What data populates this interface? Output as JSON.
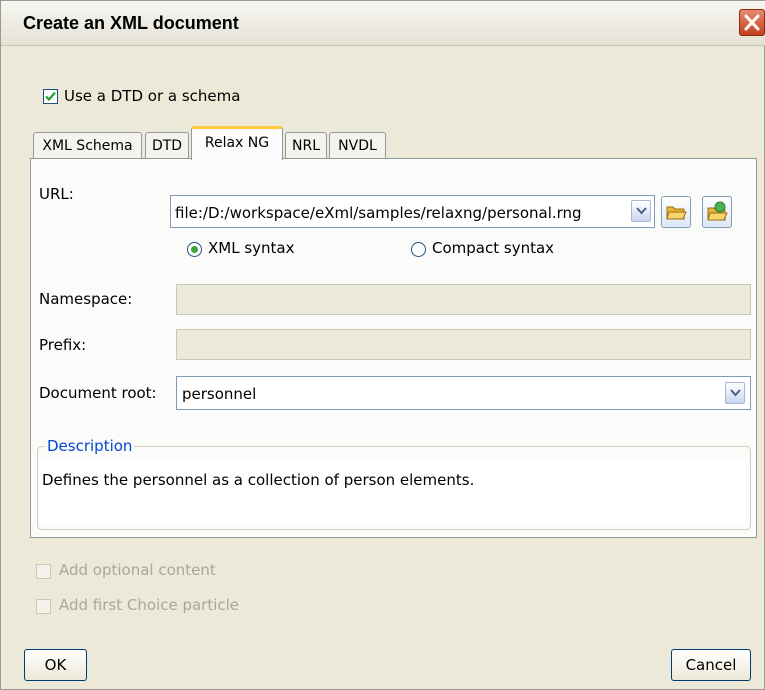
{
  "dialog": {
    "title": "Create an XML document",
    "use_schema_checkbox": {
      "label": "Use a DTD or a schema",
      "checked": true
    }
  },
  "tabs": [
    {
      "label": "XML Schema",
      "active": false
    },
    {
      "label": "DTD",
      "active": false
    },
    {
      "label": "Relax NG",
      "active": true
    },
    {
      "label": "NRL",
      "active": false
    },
    {
      "label": "NVDL",
      "active": false
    }
  ],
  "form": {
    "url_label": "URL:",
    "url_value": "file:/D:/workspace/eXml/samples/relaxng/personal.rng",
    "syntax_options": [
      {
        "label": "XML syntax",
        "selected": true
      },
      {
        "label": "Compact syntax",
        "selected": false
      }
    ],
    "namespace_label": "Namespace:",
    "namespace_value": "",
    "prefix_label": "Prefix:",
    "prefix_value": "",
    "document_root_label": "Document root:",
    "document_root_value": "personnel"
  },
  "description": {
    "legend": "Description",
    "text": "Defines the personnel as a collection of person elements."
  },
  "options": {
    "optional_content": {
      "label": "Add optional content",
      "checked": false,
      "enabled": false
    },
    "first_choice": {
      "label": "Add first Choice particle",
      "checked": false,
      "enabled": false
    }
  },
  "buttons": {
    "ok": "OK",
    "cancel": "Cancel"
  },
  "icons": {
    "close": "close-icon",
    "dropdown": "chevron-down-icon",
    "browse_local": "open-folder-icon",
    "browse_url": "open-url-folder-icon"
  },
  "colors": {
    "dialog_bg": "#ece9d8",
    "active_tab_accent": "#ffc73c",
    "legend_text": "#0046d5",
    "close_button": "#c2411f",
    "checkmark": "#21a121"
  }
}
